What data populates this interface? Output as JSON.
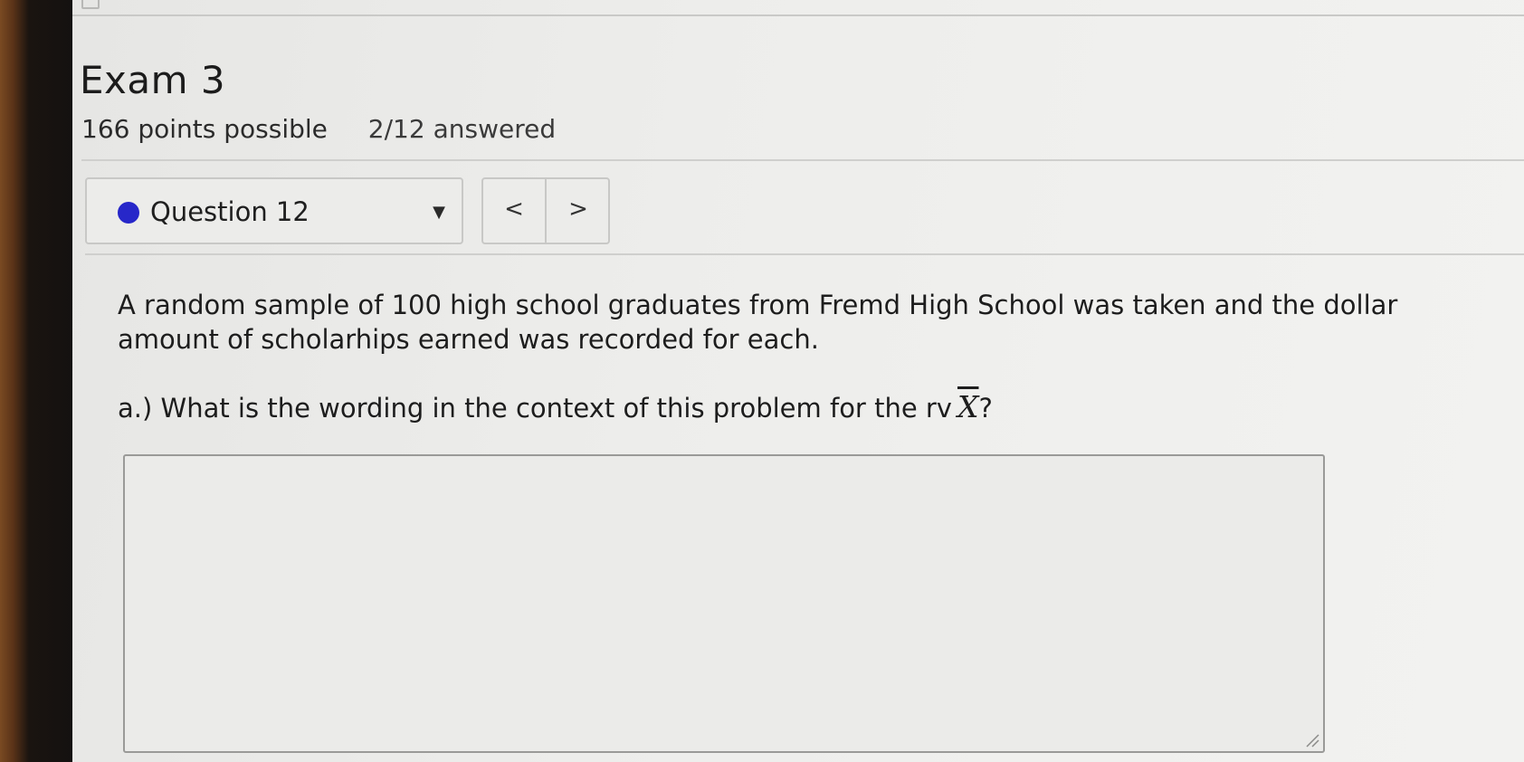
{
  "exam": {
    "title": "Exam 3",
    "points": "166 points possible",
    "answered": "2/12 answered"
  },
  "question_nav": {
    "selected": "Question 12",
    "status_color": "#2727c9",
    "prev_label": "<",
    "next_label": ">"
  },
  "question": {
    "prompt": "A random sample of 100 high school graduates from Fremd High School was taken and the dollar amount of scholarhips earned was recorded for each.",
    "part_a_prefix": "a.) What is the wording in the context of this problem for the rv",
    "part_a_variable": "X",
    "part_a_suffix": "?"
  },
  "answer": {
    "value": ""
  }
}
